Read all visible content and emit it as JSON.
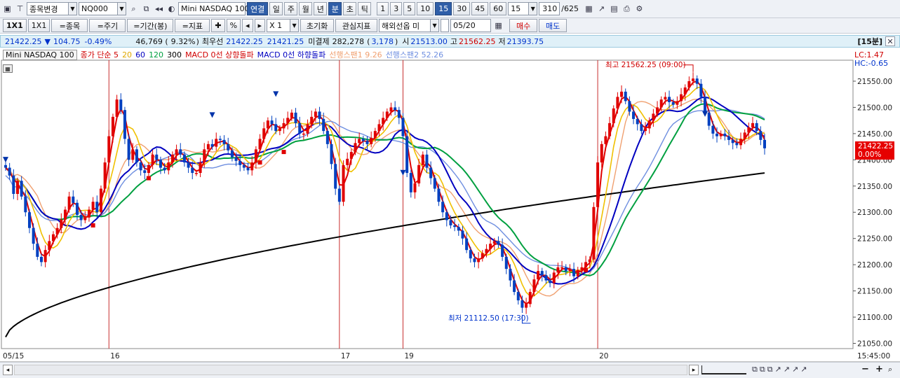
{
  "toolbar1": {
    "search_field": "종목변경",
    "code": "NQ000",
    "instrument": "Mini NASDAQ 100",
    "link_label": "연결",
    "periods": [
      "일",
      "주",
      "월",
      "년",
      "분",
      "초",
      "틱"
    ],
    "selected_period": "분",
    "intervals": [
      "1",
      "3",
      "5",
      "10",
      "15",
      "30",
      "45",
      "60"
    ],
    "selected_interval": "15",
    "interval_value": "15",
    "count": "310",
    "total": "/625"
  },
  "toolbar2": {
    "layout_a": "1X1",
    "layout_b": "1X1",
    "btn_item": "=종목",
    "btn_cycle": "=주기",
    "btn_period": "=기간(봉)",
    "btn_indicator": "=지표",
    "plus": "✚",
    "percent": "%",
    "zoom": "X 1",
    "reset": "초기화",
    "watch": "관심지표",
    "overseas": "해외선옵 미",
    "date": "05/20",
    "buy": "매수",
    "sell": "매도"
  },
  "infobar": {
    "price": "21422.25",
    "arrow": "▼",
    "change": "104.75",
    "change_pct": "-0.49%",
    "volume": "46,769 (",
    "vol_pct": "9.32%",
    "vol_close": ")",
    "best_label": "최우선",
    "best_ask": "21422.25",
    "best_bid": "21421.25",
    "oi_label": "미결제",
    "oi": "282,278",
    "oi_paren_open": "(",
    "oi_change": "3,178",
    "oi_paren_close": ")",
    "low_prefix": "시",
    "open": "21513.00",
    "high_label": "고",
    "high": "21562.25",
    "lowlabel": "저",
    "low": "21393.75",
    "interval_badge": "[15분]"
  },
  "legend": {
    "instrument": "Mini NASDAQ 100",
    "ma_label": "종가 단순 5",
    "ma20": "20",
    "ma60": "60",
    "ma120": "120",
    "ma300": "300",
    "macd_up": "MACD 0선 상향돌파",
    "macd_down": "MACD 0선 하향돌파",
    "span1": "선행스팬1 9.26",
    "span2": "선행스팬2 52.26"
  },
  "chart_labels": {
    "lc": "LC:1.47",
    "hc": "HC:-0.65",
    "high_note": "최고 21562.25 (09:00)",
    "low_note": "최저 21112.50 (17:30)",
    "price_tag": "21422.25",
    "pct_tag": "0.00%",
    "date_1": "05/15",
    "date_2": "16",
    "date_3": "17",
    "date_4": "19",
    "date_5": "20",
    "time_right": "15:45:00"
  },
  "colors": {
    "ma5": "#e00000",
    "ma20": "#f0c000",
    "ma60": "#0000c0",
    "ma120": "#00a040",
    "ma300": "#000000",
    "span1": "#f0a070",
    "span2": "#6f8fe0",
    "up_candle": "#e00000",
    "down_candle": "#0040c0"
  },
  "chart_data": {
    "type": "candlestick",
    "ylim": [
      21040,
      21590
    ],
    "yticks": [
      21050,
      21100,
      21150,
      21200,
      21250,
      21300,
      21350,
      21400,
      21450,
      21500,
      21550
    ],
    "last_price": 21422.25,
    "high": 21562.25,
    "low": 21112.5,
    "session_breaks": [
      "16",
      "17",
      "19",
      "20"
    ],
    "close_series": [
      21385,
      21370,
      21335,
      21360,
      21330,
      21300,
      21270,
      21240,
      21215,
      21205,
      21228,
      21245,
      21258,
      21270,
      21286,
      21305,
      21330,
      21318,
      21295,
      21285,
      21290,
      21305,
      21320,
      21300,
      21345,
      21395,
      21445,
      21482,
      21515,
      21495,
      21440,
      21400,
      21420,
      21395,
      21380,
      21375,
      21390,
      21410,
      21400,
      21385,
      21380,
      21395,
      21410,
      21420,
      21410,
      21395,
      21385,
      21375,
      21375,
      21395,
      21420,
      21430,
      21425,
      21440,
      21438,
      21430,
      21418,
      21405,
      21398,
      21390,
      21385,
      21380,
      21395,
      21420,
      21440,
      21460,
      21475,
      21468,
      21455,
      21460,
      21470,
      21480,
      21490,
      21470,
      21450,
      21450,
      21468,
      21482,
      21492,
      21478,
      21455,
      21430,
      21392,
      21345,
      21320,
      21390,
      21402,
      21415,
      21432,
      21440,
      21436,
      21430,
      21442,
      21455,
      21468,
      21480,
      21492,
      21500,
      21495,
      21480,
      21445,
      21375,
      21338,
      21355,
      21390,
      21410,
      21385,
      21365,
      21345,
      21320,
      21300,
      21285,
      21275,
      21272,
      21265,
      21250,
      21228,
      21212,
      21205,
      21212,
      21222,
      21230,
      21240,
      21245,
      21238,
      21215,
      21192,
      21170,
      21148,
      21132,
      21118,
      21125,
      21148,
      21172,
      21188,
      21180,
      21170,
      21165,
      21185,
      21195,
      21195,
      21188,
      21192,
      21178,
      21190,
      21195,
      21205,
      21210,
      21310,
      21395,
      21430,
      21445,
      21470,
      21498,
      21520,
      21530,
      21512,
      21492,
      21478,
      21468,
      21455,
      21460,
      21475,
      21488,
      21500,
      21515,
      21520,
      21510,
      21505,
      21512,
      21525,
      21538,
      21550,
      21555,
      21545,
      21520,
      21490,
      21465,
      21450,
      21445,
      21450,
      21445,
      21438,
      21432,
      21428,
      21440,
      21452,
      21462,
      21470,
      21455,
      21438,
      21422
    ]
  },
  "bottom": {
    "zoom_minus": "−",
    "zoom_plus": "+"
  }
}
